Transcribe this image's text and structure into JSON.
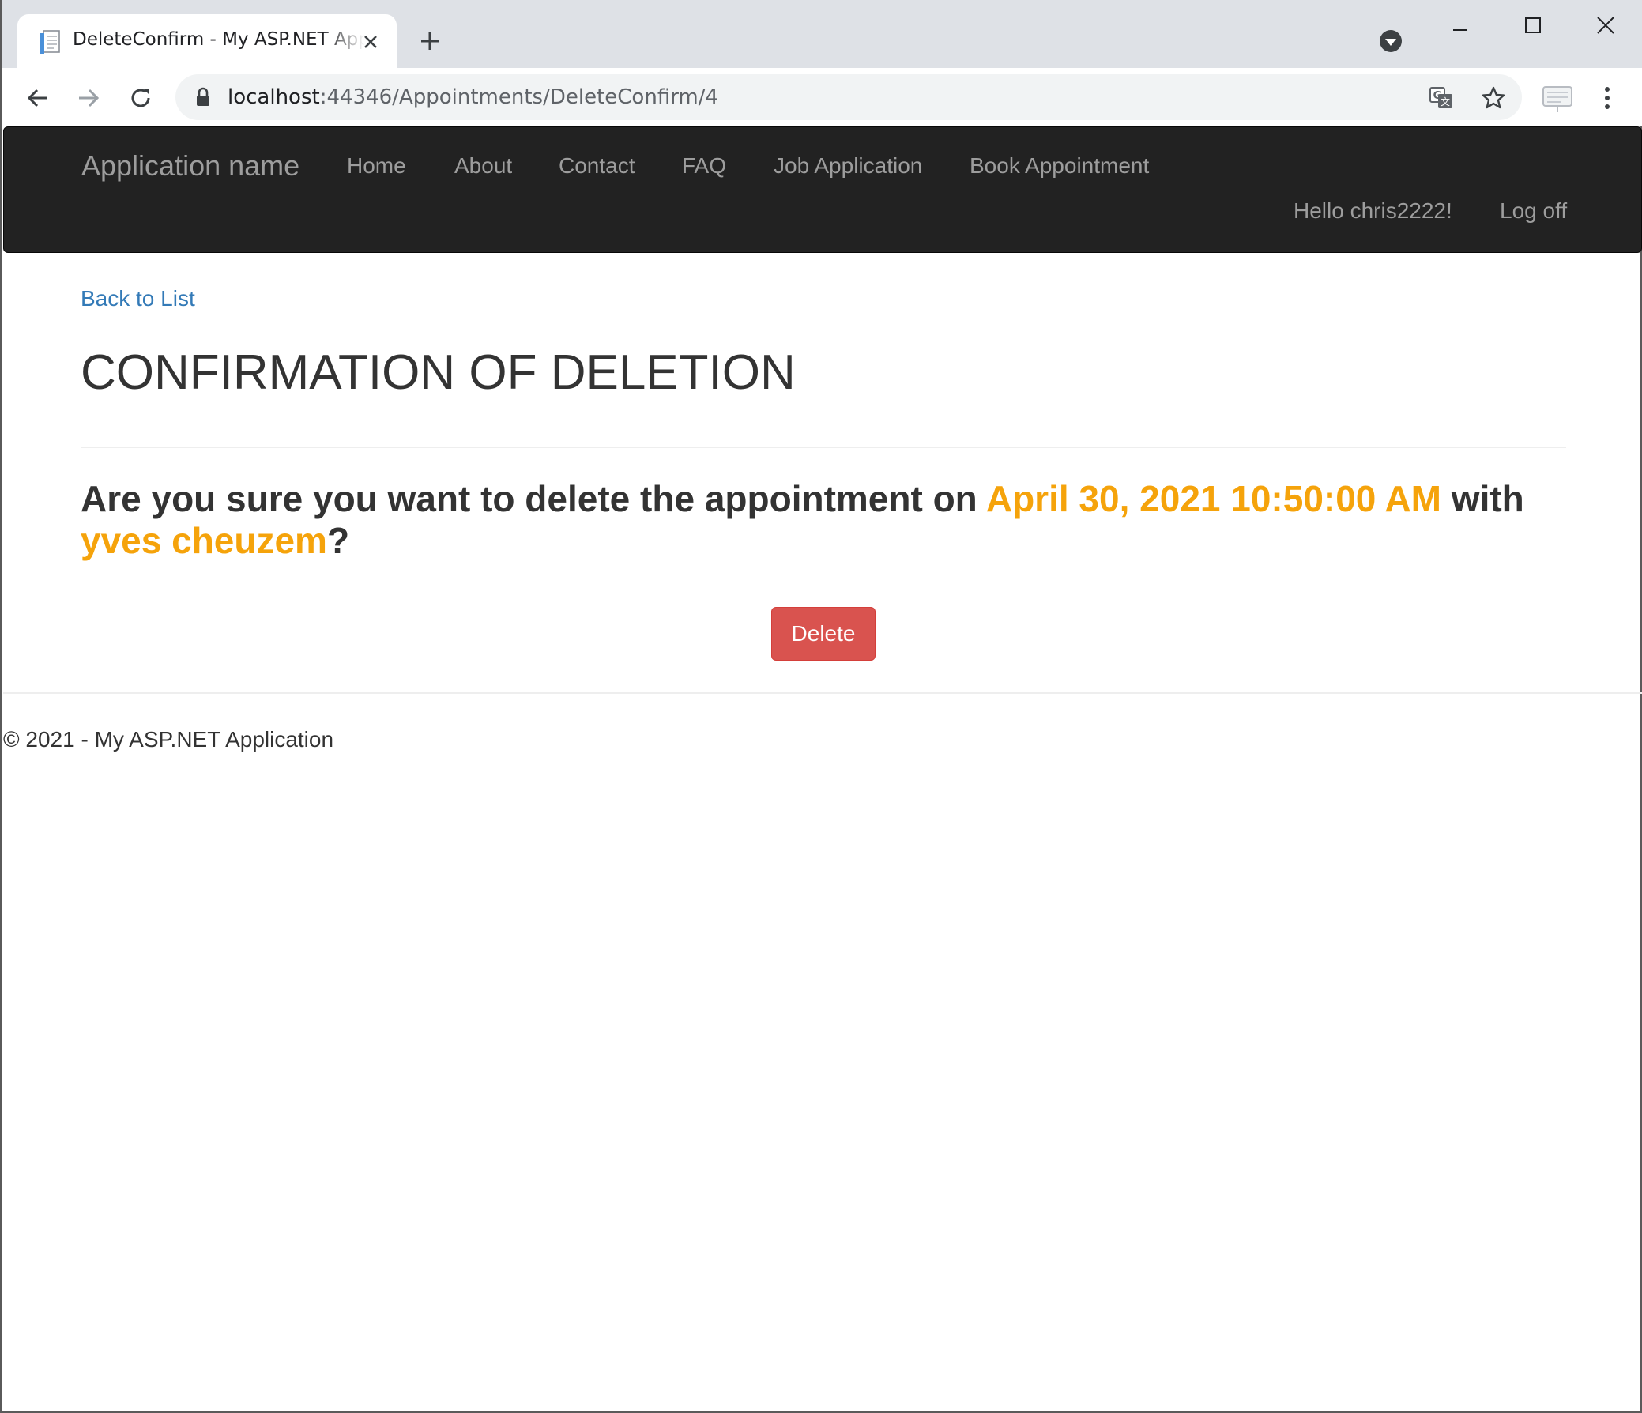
{
  "browser": {
    "tab_title": "DeleteConfirm - My ASP.NET Application",
    "url_host": "localhost",
    "url_path": ":44346/Appointments/DeleteConfirm/4"
  },
  "navbar": {
    "brand": "Application name",
    "links": [
      "Home",
      "About",
      "Contact",
      "FAQ",
      "Job Application",
      "Book Appointment"
    ],
    "greeting": "Hello chris2222!",
    "logoff": "Log off"
  },
  "content": {
    "back_link": "Back to List",
    "title": "CONFIRMATION OF DELETION",
    "question_prefix": "Are you sure you want to delete the appointment on ",
    "appointment_date": "April 30, 2021 10:50:00 AM",
    "question_middle": " with ",
    "person_name": "yves cheuzem",
    "question_suffix": "?",
    "delete_button": "Delete"
  },
  "footer": {
    "text": "© 2021 - My ASP.NET Application"
  },
  "colors": {
    "navbar_bg": "#222222",
    "link": "#337ab7",
    "highlight": "#f5a30b",
    "danger": "#d9534f"
  }
}
